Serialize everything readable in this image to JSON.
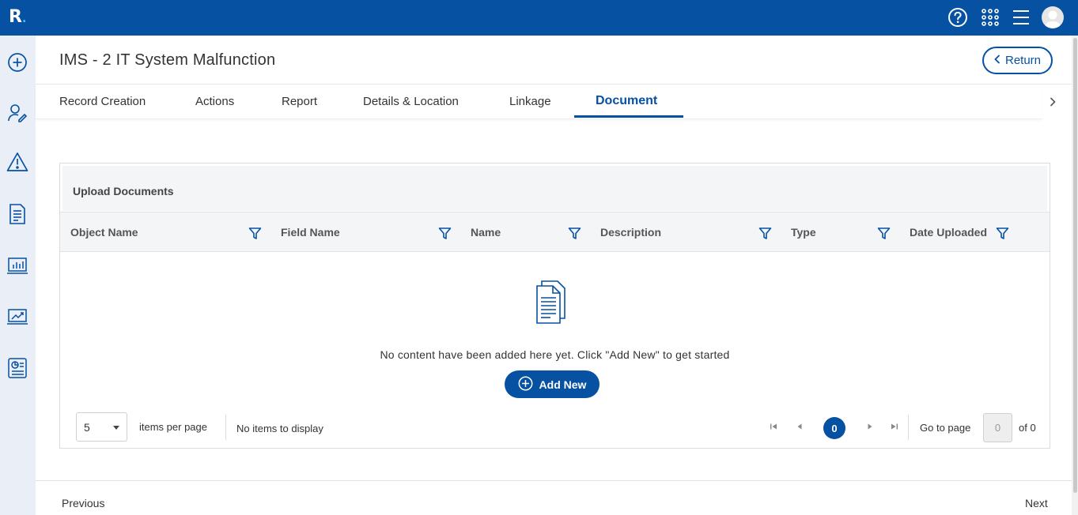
{
  "app": {
    "logo_letter": "R",
    "logo_dot": "."
  },
  "topbar": {
    "icons": [
      "help-icon",
      "apps-grid-icon",
      "menu-icon",
      "user-avatar"
    ]
  },
  "sidebar": {
    "icons": [
      "add-circle-icon",
      "user-edit-icon",
      "warning-icon",
      "document-list-icon",
      "bar-chart-icon",
      "trend-chart-icon",
      "report-icon"
    ]
  },
  "page": {
    "title": "IMS - 2 IT System Malfunction",
    "return_label": "Return"
  },
  "tabs": [
    {
      "label": "Record Creation",
      "active": false
    },
    {
      "label": "Actions",
      "active": false
    },
    {
      "label": "Report",
      "active": false
    },
    {
      "label": "Details & Location",
      "active": false
    },
    {
      "label": "Linkage",
      "active": false
    },
    {
      "label": "Document",
      "active": true
    }
  ],
  "panel": {
    "title": "Upload Documents",
    "columns": [
      "Object Name",
      "Field Name",
      "Name",
      "Description",
      "Type",
      "Date Uploaded"
    ],
    "empty_message": "No content have been added here yet. Click \"Add New\" to get started",
    "add_new_label": "Add New"
  },
  "pager": {
    "page_size": "5",
    "items_per_page_label": "items per page",
    "status": "No items to display",
    "current_page": "0",
    "go_to_label": "Go to page",
    "go_to_value": "0",
    "of_label": "of 0"
  },
  "footer": {
    "previous_label": "Previous",
    "next_label": "Next"
  },
  "colors": {
    "primary": "#0651a2",
    "sidebar_bg": "#e9eef7",
    "header_bg": "#f4f5f7"
  }
}
